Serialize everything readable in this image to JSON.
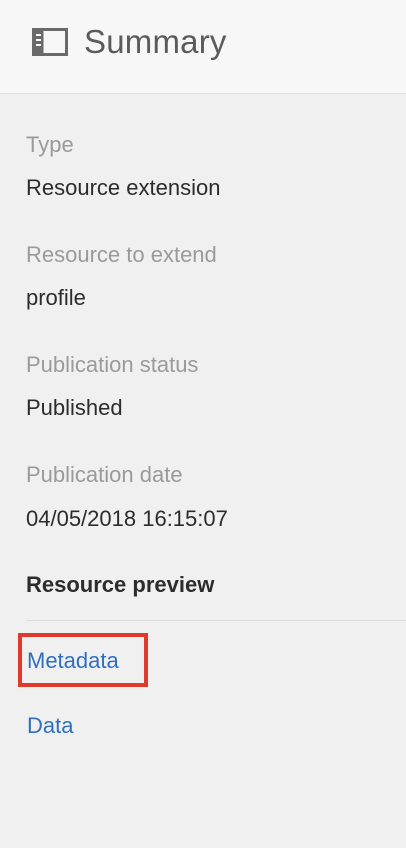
{
  "header": {
    "title": "Summary",
    "icon": "panel-layout-icon"
  },
  "fields": [
    {
      "label": "Type",
      "value": "Resource extension"
    },
    {
      "label": "Resource to extend",
      "value": "profile"
    },
    {
      "label": "Publication status",
      "value": "Published"
    },
    {
      "label": "Publication date",
      "value": "04/05/2018 16:15:07"
    }
  ],
  "preview": {
    "heading": "Resource preview",
    "links": [
      {
        "label": "Metadata",
        "highlighted": true
      },
      {
        "label": "Data",
        "highlighted": false
      }
    ]
  },
  "colors": {
    "link": "#2f6fc0",
    "highlight": "#e03a2c",
    "label": "#9a9a9a",
    "value": "#2c2c2c"
  }
}
